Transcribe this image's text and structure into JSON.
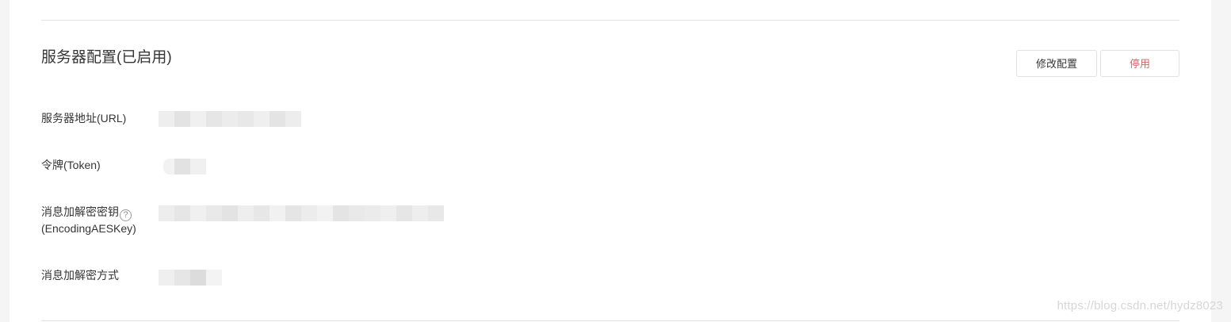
{
  "section": {
    "title": "服务器配置(已启用)"
  },
  "actions": {
    "modify_label": "修改配置",
    "disable_label": "停用",
    "disable_color": "#e15f63"
  },
  "fields": {
    "url_label": "服务器地址(URL)",
    "token_label": "令牌(Token)",
    "aes_label": "消息加解密密钥",
    "aes_label_sub": "(EncodingAESKey)",
    "aes_help_icon": "question-circle-icon",
    "aes_help_glyph": "?",
    "mode_label": "消息加解密方式"
  },
  "watermark": "https://blog.csdn.net/hydz8023"
}
